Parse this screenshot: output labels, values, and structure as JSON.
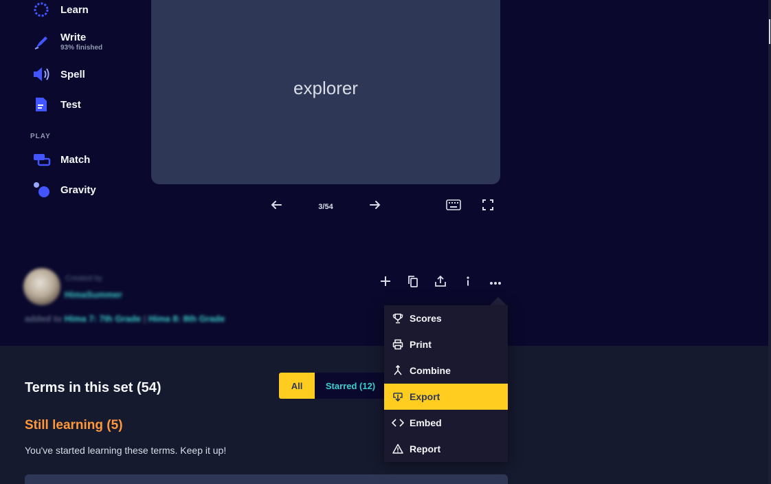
{
  "sidebar": {
    "modes": [
      {
        "label": "Learn",
        "sub": "",
        "icon": "learn-icon"
      },
      {
        "label": "Write",
        "sub": "93% finished",
        "icon": "write-icon"
      },
      {
        "label": "Spell",
        "sub": "",
        "icon": "spell-icon"
      },
      {
        "label": "Test",
        "sub": "",
        "icon": "test-icon"
      }
    ],
    "play_label": "PLAY",
    "games": [
      {
        "label": "Match",
        "icon": "match-icon"
      },
      {
        "label": "Gravity",
        "icon": "gravity-icon"
      }
    ]
  },
  "flashcard": {
    "term": "explorer",
    "counter": "3/54"
  },
  "creator": {
    "role": "Created by",
    "name": "HimaSummer",
    "added_prefix": "added to",
    "class_1": "Hima 7: 7th Grade",
    "separator": "|",
    "class_2": "Hima 8: 8th Grade"
  },
  "menu": {
    "items": [
      {
        "label": "Scores",
        "icon": "trophy-icon",
        "active": false
      },
      {
        "label": "Print",
        "icon": "printer-icon",
        "active": false
      },
      {
        "label": "Combine",
        "icon": "combine-icon",
        "active": false
      },
      {
        "label": "Export",
        "icon": "export-icon",
        "active": true
      },
      {
        "label": "Embed",
        "icon": "embed-icon",
        "active": false
      },
      {
        "label": "Report",
        "icon": "warning-icon",
        "active": false
      }
    ]
  },
  "terms": {
    "title": "Terms in this set (54)",
    "filter_all": "All",
    "filter_starred": "Starred (12)",
    "still_title": "Still learning (5)",
    "still_desc": "You've started learning these terms. Keep it up!"
  },
  "colors": {
    "background": "#0a092d",
    "card": "#2e3856",
    "accent_yellow": "#ffcd1f",
    "accent_blue": "#4255ff",
    "teal": "#3ccfcf",
    "orange": "#ff983a"
  }
}
